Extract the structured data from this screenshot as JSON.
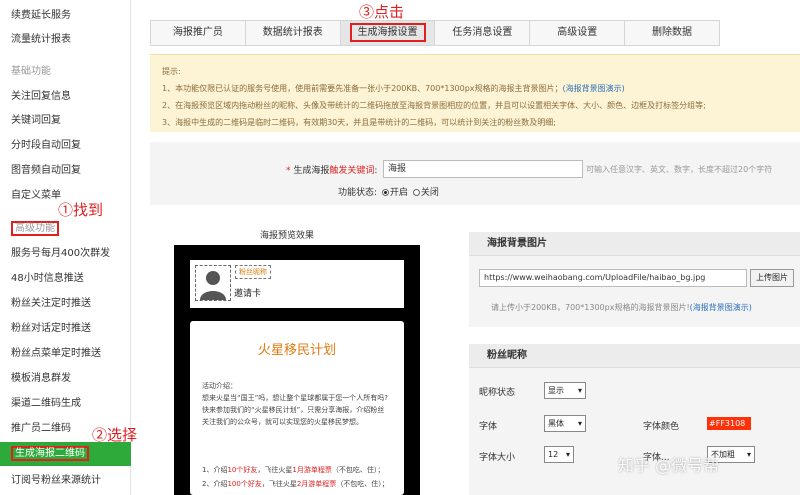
{
  "sidebar": {
    "items": [
      {
        "label": "续费延长服务"
      },
      {
        "label": "流量统计报表"
      },
      {
        "label": "基础功能"
      },
      {
        "label": "关注回复信息"
      },
      {
        "label": "关键词回复"
      },
      {
        "label": "分时段自动回复"
      },
      {
        "label": "图音频自动回复"
      },
      {
        "label": "自定义菜单"
      },
      {
        "label": "高级功能"
      },
      {
        "label": "服务号每月400次群发"
      },
      {
        "label": "48小时信息推送"
      },
      {
        "label": "粉丝关注定时推送"
      },
      {
        "label": "粉丝对话定时推送"
      },
      {
        "label": "粉丝点菜单定时推送"
      },
      {
        "label": "模板消息群发"
      },
      {
        "label": "渠道二维码生成"
      },
      {
        "label": "推广员二维码"
      },
      {
        "label": "生成海报二维码"
      },
      {
        "label": "订阅号粉丝来源统计"
      }
    ]
  },
  "annotations": {
    "step1": "①找到",
    "step2": "②选择",
    "step3": "③点击"
  },
  "tabs": [
    {
      "label": "海报推广员"
    },
    {
      "label": "数据统计报表"
    },
    {
      "label": "生成海报设置"
    },
    {
      "label": "任务消息设置"
    },
    {
      "label": "高级设置"
    },
    {
      "label": "删除数据"
    }
  ],
  "notice": {
    "heading": "提示:",
    "line1": "1、本功能仅限已认证的服务号使用，使用前需要先准备一张小于200KB、700*1300px规格的海报主背景图片；",
    "line1_link": "(海报背景图演示)",
    "line2": "2、在海报预览区域内拖动粉丝的昵称、头像及带统计的二维码拖放至海报背景图相应的位置，并且可以设置相关字体、大小、颜色、边框及打标签分组等;",
    "line3": "3、海报中生成的二维码是临时二维码，有效期30天，并且是带统计的二维码，可以统计到关注的粉丝数及明细;"
  },
  "form": {
    "keyword_label": "生成海报",
    "keyword_label_red": "触发关键词",
    "keyword_value": "海报",
    "keyword_hint": "可输入任意汉字、英文、数字，长度不超过20个字符",
    "status_label": "功能状态:",
    "status_on": "开启",
    "status_off": "关闭"
  },
  "preview": {
    "title": "海报预览效果",
    "nickname": "粉丝昵称",
    "invite": "邀请卡",
    "poster_title": "火星移民计划",
    "intro_heading": "活动介绍：",
    "intro1": "想来火星当“国王”吗，想让整个星球都属于您一个人所有吗?",
    "intro2": "快来参加我们的“火星移民计划”，只需分享海报，介绍粉丝",
    "intro3": "关注我们的公众号，就可以实现您的火星移民梦想。",
    "rule1": "1、介绍10个好友，飞往火星1月游单程票（不包吃、住）；",
    "rule2": "2、介绍100个好友，飞往火星2月游单程票（不包吃、住）；"
  },
  "bg_panel": {
    "heading": "海报背景图片",
    "url": "https://www.weihaobang.com/UploadFile/haibao_bg.jpg",
    "upload_button": "上传图片",
    "hint": "请上传小于200KB，700*1300px规格的海报背景图片!",
    "hint_link": "(海报背景图演示)"
  },
  "nick_panel": {
    "heading": "粉丝昵称",
    "status_label": "昵称状态",
    "status_value": "显示",
    "font_label": "字体",
    "font_value": "黑体",
    "color_label": "字体颜色",
    "color_value": "#FF3108",
    "size_label": "字体大小",
    "size_value": "12",
    "align_label": "字体...",
    "align_value": "不加粗"
  },
  "watermark": "知乎 @微号帮",
  "colors": {
    "selected_green": "#2eaa3a",
    "annotation_red": "#e02020",
    "notice_bg": "#fdf3d5",
    "nick_color": "#FF3108"
  }
}
